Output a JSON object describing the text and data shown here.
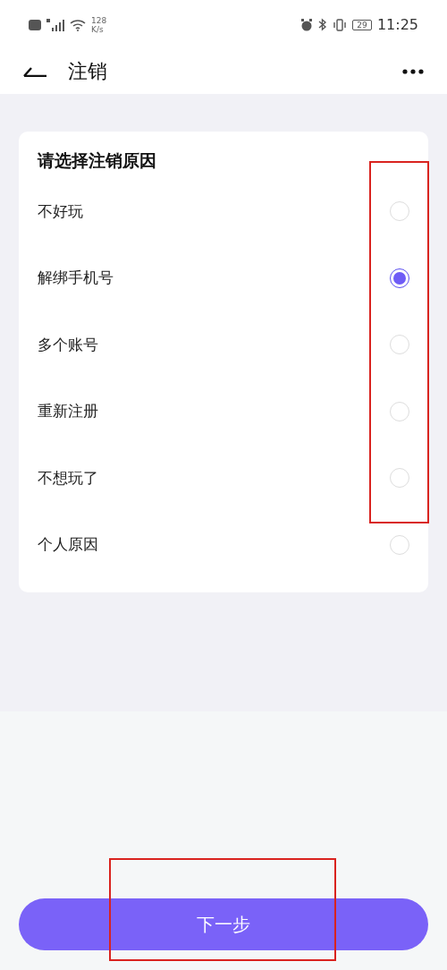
{
  "status_bar": {
    "speed_value": "128",
    "speed_unit": "K/s",
    "battery": "29",
    "time": "11:25"
  },
  "header": {
    "title": "注销"
  },
  "card": {
    "title": "请选择注销原因",
    "options": [
      {
        "label": "不好玩",
        "selected": false
      },
      {
        "label": "解绑手机号",
        "selected": true
      },
      {
        "label": "多个账号",
        "selected": false
      },
      {
        "label": "重新注册",
        "selected": false
      },
      {
        "label": "不想玩了",
        "selected": false
      },
      {
        "label": "个人原因",
        "selected": false
      }
    ]
  },
  "next_button": "下一步"
}
